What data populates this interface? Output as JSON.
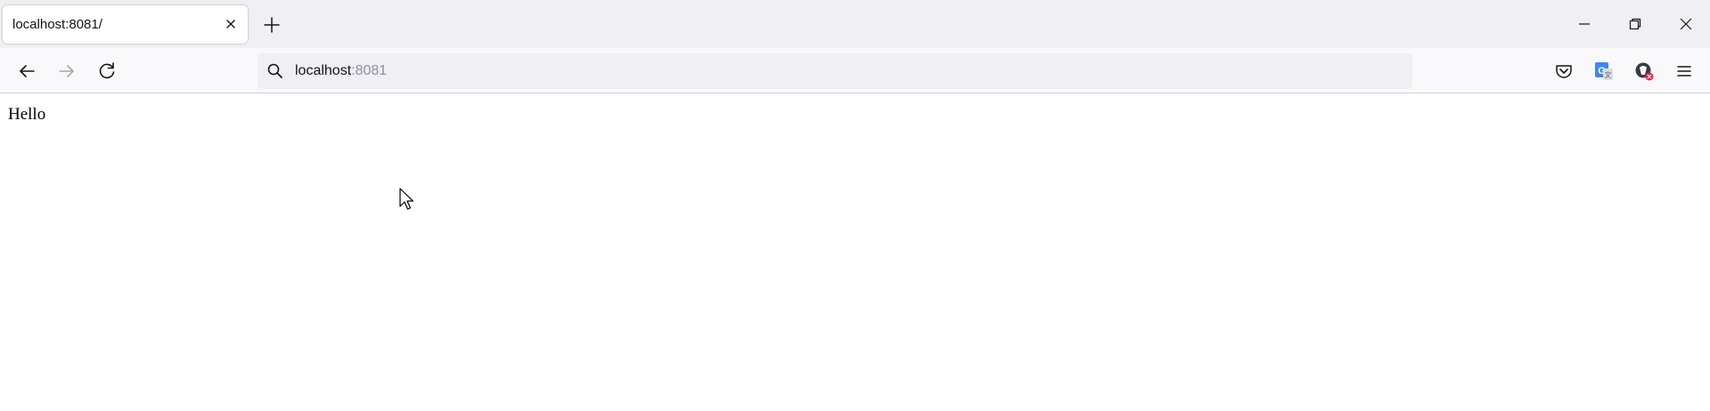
{
  "tab": {
    "title": "localhost:8081/"
  },
  "address_bar": {
    "host": "localhost",
    "port": ":8081"
  },
  "page": {
    "text": "Hello"
  },
  "icons": {
    "tab_close": "close-icon",
    "new_tab": "plus-icon",
    "minimize": "minimize-icon",
    "restore": "restore-icon",
    "close_window": "close-icon",
    "back": "arrow-left-icon",
    "forward": "arrow-right-icon",
    "reload": "reload-icon",
    "search": "search-icon",
    "pocket": "pocket-icon",
    "translate": "translate-icon",
    "extension": "extension-icon",
    "menu": "hamburger-menu-icon"
  },
  "colors": {
    "tabstrip_bg": "#f0f0f4",
    "navbar_bg": "#f9f9fb",
    "urlbar_bg": "#f0f0f4",
    "port_text": "#8f8f9d",
    "translate_blue": "#4285f4",
    "badge_red": "#e22850"
  }
}
